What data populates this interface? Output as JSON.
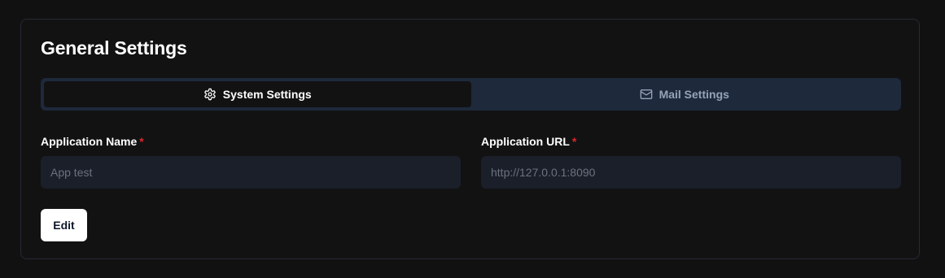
{
  "page": {
    "title": "General Settings"
  },
  "tabs": [
    {
      "label": "System Settings",
      "icon": "gear-icon",
      "active": true
    },
    {
      "label": "Mail Settings",
      "icon": "mail-icon",
      "active": false
    }
  ],
  "form": {
    "app_name": {
      "label": "Application Name",
      "required_mark": "*",
      "value": "",
      "placeholder": "App test"
    },
    "app_url": {
      "label": "Application URL",
      "required_mark": "*",
      "value": "",
      "placeholder": "http://127.0.0.1:8090"
    }
  },
  "actions": {
    "edit_label": "Edit"
  },
  "colors": {
    "background": "#111112",
    "tab_bar": "#1e293b",
    "input_bg": "#1a1f29",
    "required": "#dc2626"
  }
}
